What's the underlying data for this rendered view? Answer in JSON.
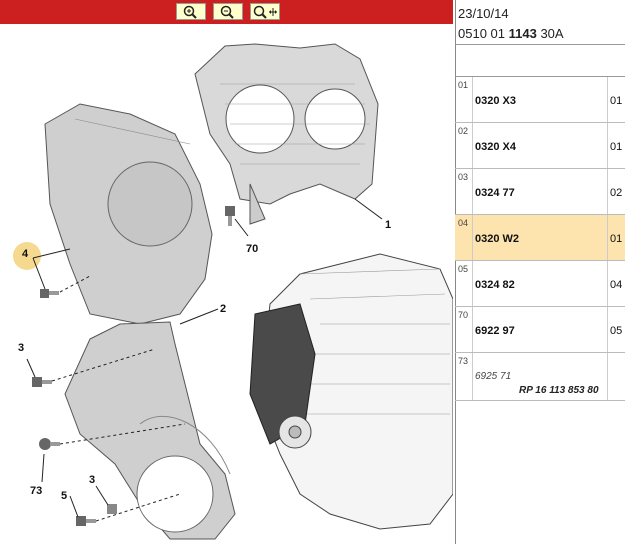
{
  "toolbar": {
    "zoom_in_label": "+",
    "zoom_out_label": "−",
    "fit_label": "⤧"
  },
  "callouts": {
    "c1": "1",
    "c2": "2",
    "c3a": "3",
    "c3b": "3",
    "c4": "4",
    "c5": "5",
    "c70": "70",
    "c73": "73"
  },
  "header": {
    "date": "23/10/14",
    "code_prefix": "0510 01",
    "code_bold": "1143",
    "code_suffix": "30A"
  },
  "parts": [
    {
      "index": "01",
      "ref": "0320 X3",
      "qty": "01"
    },
    {
      "index": "02",
      "ref": "0320 X4",
      "qty": "01"
    },
    {
      "index": "03",
      "ref": "0324 77",
      "qty": "02"
    },
    {
      "index": "04",
      "ref": "0320 W2",
      "qty": "01"
    },
    {
      "index": "05",
      "ref": "0324 82",
      "qty": "04"
    },
    {
      "index": "70",
      "ref": "6922 97",
      "qty": "05"
    }
  ],
  "last_part": {
    "index": "73",
    "ref": "6925 71",
    "note": "RP 16 113 853 80"
  },
  "colors": {
    "toolbar": "#cc1f1f",
    "selected_row": "#fde3ad",
    "highlight": "#f3d27a"
  }
}
